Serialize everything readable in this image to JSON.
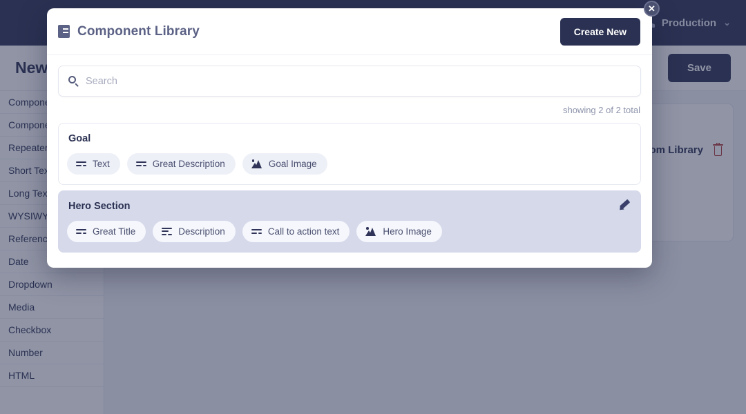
{
  "background": {
    "topbar": {
      "env_icon": "sitemap-icon",
      "env_label": "Production",
      "chevron": "⌄"
    },
    "page_title": "New",
    "save_label": "Save",
    "sidebar_items": [
      {
        "label": "Component"
      },
      {
        "label": "Component"
      },
      {
        "label": "Repeater"
      },
      {
        "label": "Short Text"
      },
      {
        "label": "Long Text"
      },
      {
        "label": "WYSIWYG"
      },
      {
        "label": "Reference"
      },
      {
        "label": "Date"
      },
      {
        "label": "Dropdown"
      },
      {
        "label": "Media"
      },
      {
        "label": "Checkbox"
      },
      {
        "label": "Number"
      },
      {
        "label": "HTML"
      }
    ],
    "content_card": {
      "add_from_library_label": "Add from Library",
      "delete_icon": "trash-icon"
    }
  },
  "modal": {
    "title": "Component Library",
    "title_icon": "book-icon",
    "create_label": "Create New",
    "close_label": "✕",
    "search": {
      "icon": "search-icon",
      "placeholder": "Search",
      "value": ""
    },
    "count_text": "showing 2 of 2 total",
    "components": [
      {
        "name": "Goal",
        "selected": false,
        "editable": false,
        "fields": [
          {
            "label": "Text",
            "icon": "short-text-icon"
          },
          {
            "label": "Great Description",
            "icon": "short-text-icon"
          },
          {
            "label": "Goal Image",
            "icon": "image-icon"
          }
        ]
      },
      {
        "name": "Hero Section",
        "selected": true,
        "editable": true,
        "edit_icon": "pencil-icon",
        "fields": [
          {
            "label": "Great Title",
            "icon": "short-text-icon"
          },
          {
            "label": "Description",
            "icon": "long-text-icon"
          },
          {
            "label": "Call to action text",
            "icon": "short-text-icon"
          },
          {
            "label": "Hero Image",
            "icon": "image-icon"
          }
        ]
      }
    ]
  },
  "colors": {
    "brand_dark": "#2b3152",
    "selected_card": "#d5d9ea",
    "chip_bg": "#eef0f8",
    "muted_text": "#8d93aa",
    "danger": "#b03a3a"
  }
}
